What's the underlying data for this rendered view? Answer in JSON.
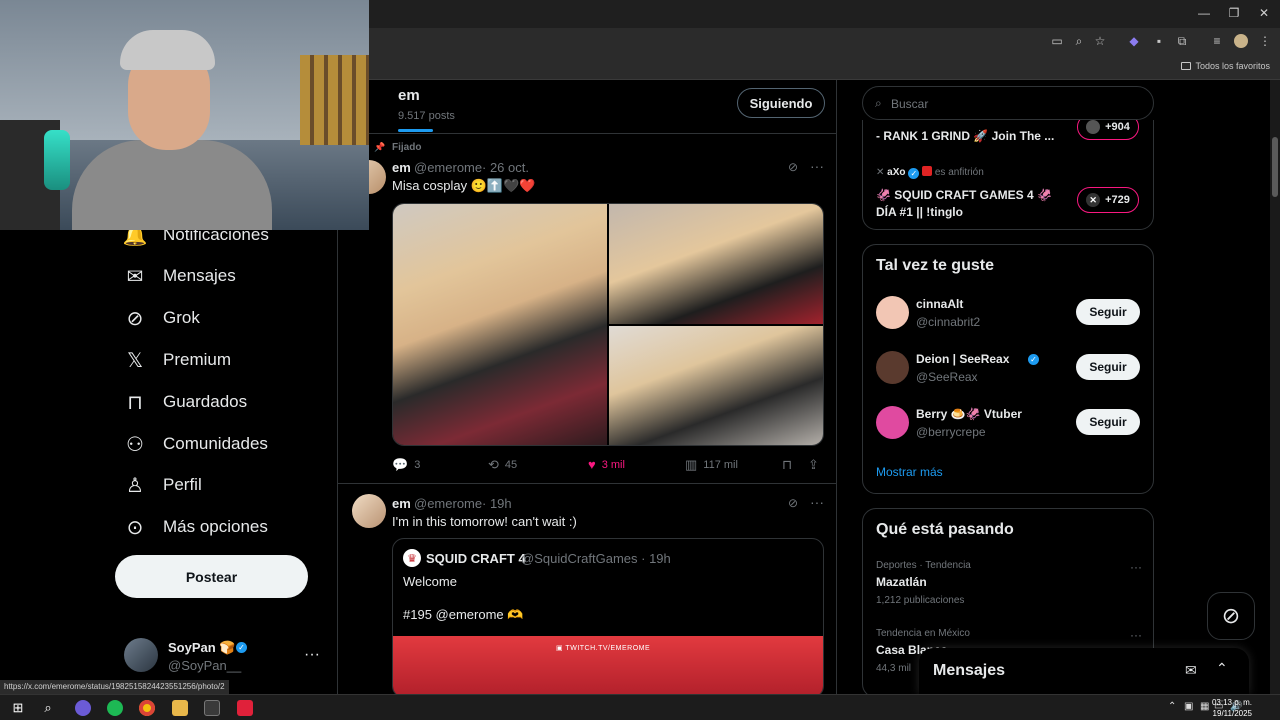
{
  "browser": {
    "window_controls": [
      "—",
      "❐",
      "✕"
    ],
    "bookmarks_folder": "Todos los favoritos",
    "status_url": "https://x.com/emerome/status/1982515824423551256/photo/2"
  },
  "sidebar": {
    "items": [
      {
        "label": "Notificaciones",
        "icon": "bell-icon",
        "glyph": "🔔"
      },
      {
        "label": "Mensajes",
        "icon": "envelope-icon",
        "glyph": "✉"
      },
      {
        "label": "Grok",
        "icon": "grok-icon",
        "glyph": "⊘"
      },
      {
        "label": "Premium",
        "icon": "x-logo-icon",
        "glyph": "𝕏"
      },
      {
        "label": "Guardados",
        "icon": "bookmark-icon",
        "glyph": "🔖"
      },
      {
        "label": "Comunidades",
        "icon": "people-icon",
        "glyph": "👥"
      },
      {
        "label": "Perfil",
        "icon": "person-icon",
        "glyph": "👤"
      },
      {
        "label": "Más opciones",
        "icon": "more-circle-icon",
        "glyph": "⋯"
      }
    ],
    "post_button": "Postear",
    "account": {
      "name": "SoyPan 🍞",
      "handle": "@SoyPan__",
      "more": "···"
    }
  },
  "profile": {
    "name": "em",
    "post_count": "9.517 posts",
    "follow_button": "Siguiendo"
  },
  "tweets": [
    {
      "pinned_label": "Fijado",
      "name": "em",
      "handle": "@emerome",
      "time": "· 26 oct.",
      "text": "Misa cosplay 🙂⬆️🖤❤️",
      "replies": "3",
      "retweets": "45",
      "likes": "3 mil",
      "views": "117 mil"
    },
    {
      "name": "em",
      "handle": "@emerome",
      "time": "· 19h",
      "text": "I'm in this tomorrow! can't wait :)",
      "quote": {
        "name": "SQUID CRAFT 4",
        "handle": "@SquidCraftGames · 19h",
        "line1": "Welcome",
        "line2": "#195 @emerome 🫶",
        "image_caption": "▣ TWITCH.TV/EMEROME"
      }
    }
  ],
  "right": {
    "search_placeholder": "Buscar",
    "live": [
      {
        "title": "- RANK 1 GRIND 🚀 Join The ...",
        "badge": "+904"
      },
      {
        "host_name": "aXo",
        "host_suffix": "es anfitrión",
        "title_line1": "🦑 SQUID CRAFT GAMES 4 🦑",
        "title_line2": "DÍA #1 || !tinglo",
        "badge": "+729"
      }
    ],
    "who_to_follow": {
      "title": "Tal vez te guste",
      "users": [
        {
          "name": "cinnaAlt",
          "handle": "@cinnabrit2",
          "button": "Seguir",
          "color": "#f2c6b4"
        },
        {
          "name": "Deion | SeeReax",
          "handle": "@SeeReax",
          "button": "Seguir",
          "color": "#5a3a2e",
          "verified": true
        },
        {
          "name": "Berry 🍮🦑 Vtuber",
          "handle": "@berrycrepe",
          "button": "Seguir",
          "color": "#e04aa0"
        }
      ],
      "show_more": "Mostrar más"
    },
    "trends": {
      "title": "Qué está pasando",
      "items": [
        {
          "category": "Deportes · Tendencia",
          "title": "Mazatlán",
          "count": "1,212 publicaciones"
        },
        {
          "category": "Tendencia en México",
          "title": "Casa Blanca",
          "count": "44,3 mil"
        }
      ]
    }
  },
  "dm_drawer": {
    "title": "Mensajes"
  },
  "taskbar": {
    "time": "03:13 p. m.",
    "date": "19/11/2025"
  }
}
